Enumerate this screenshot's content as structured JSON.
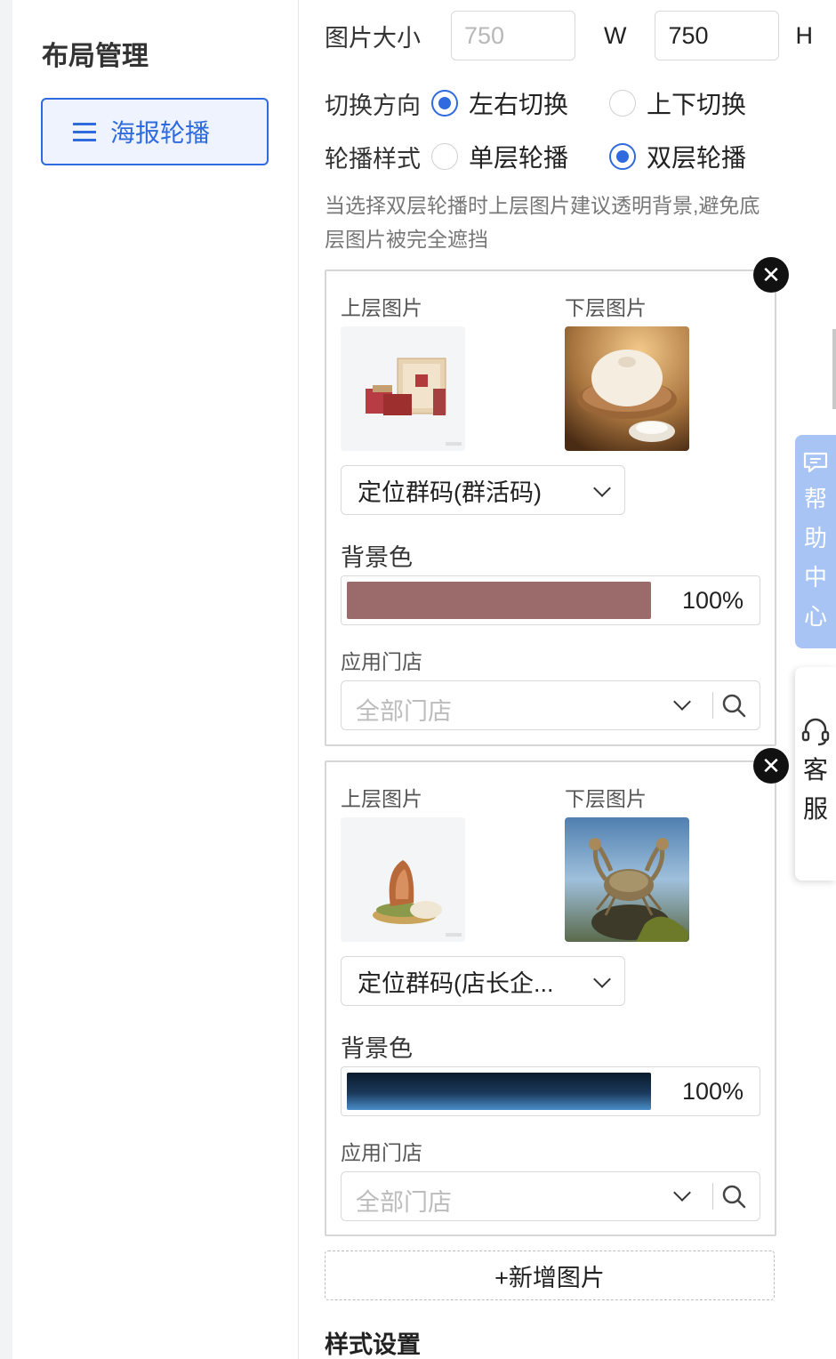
{
  "sidebar": {
    "title": "布局管理",
    "items": [
      {
        "label": "海报轮播",
        "icon": "menu-icon"
      }
    ]
  },
  "size": {
    "label": "图片大小",
    "width_placeholder": "750",
    "width_unit": "W",
    "height_value": "750",
    "height_unit": "H"
  },
  "direction": {
    "label": "切换方向",
    "options": [
      "左右切换",
      "上下切换"
    ],
    "selected": "左右切换"
  },
  "style": {
    "label": "轮播样式",
    "options": [
      "单层轮播",
      "双层轮播"
    ],
    "selected": "双层轮播"
  },
  "hint": "当选择双层轮播时上层图片建议透明背景,避免底层图片被完全遮挡",
  "cards": [
    {
      "top_label": "上层图片",
      "bottom_label": "下层图片",
      "select_value": "定位群码(群活码)",
      "bg_label": "背景色",
      "bg_color": "#9b6a6a",
      "bg_opacity": "100%",
      "store_label": "应用门店",
      "store_placeholder": "全部门店"
    },
    {
      "top_label": "上层图片",
      "bottom_label": "下层图片",
      "select_value": "定位群码(店长企...",
      "bg_label": "背景色",
      "bg_color": "#1b3a5c",
      "bg_opacity": "100%",
      "store_label": "应用门店",
      "store_placeholder": "全部门店"
    }
  ],
  "add_button": "+新增图片",
  "section_title": "样式设置",
  "floating": {
    "help_chars": [
      "帮",
      "助",
      "中",
      "心"
    ],
    "service_chars": [
      "客",
      "服"
    ]
  },
  "colors": {
    "accent": "#2f6bdf",
    "help_bg": "#a8c4f5"
  }
}
